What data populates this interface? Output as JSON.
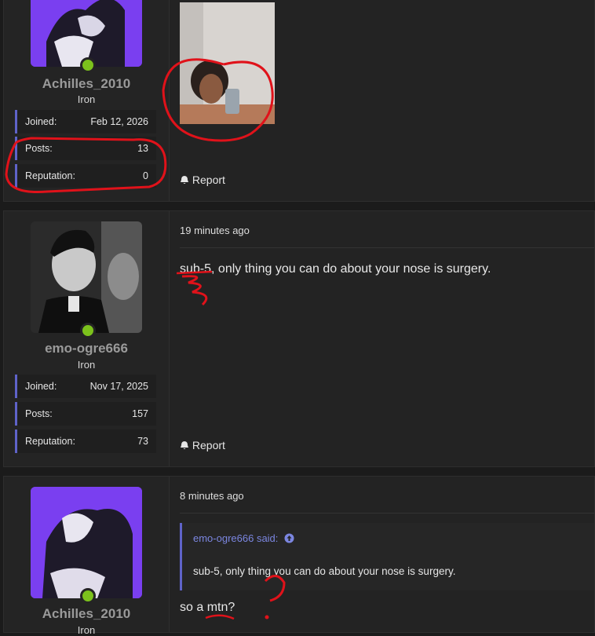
{
  "posts": [
    {
      "username": "Achilles_2010",
      "rank": "Iron",
      "stats": [
        {
          "label": "Joined:",
          "value": "Feb 12, 2026"
        },
        {
          "label": "Posts:",
          "value": "13"
        },
        {
          "label": "Reputation:",
          "value": "0"
        }
      ],
      "report": "Report"
    },
    {
      "username": "emo-ogre666",
      "rank": "Iron",
      "time": "19 minutes ago",
      "text": "sub-5, only thing you can do about your nose is surgery.",
      "stats": [
        {
          "label": "Joined:",
          "value": "Nov 17, 2025"
        },
        {
          "label": "Posts:",
          "value": "157"
        },
        {
          "label": "Reputation:",
          "value": "73"
        }
      ],
      "report": "Report"
    },
    {
      "username": "Achilles_2010",
      "rank": "Iron",
      "time": "8 minutes ago",
      "quote_author": "emo-ogre666 said:",
      "quote_text": "sub-5, only thing you can do about your nose is surgery.",
      "text": "so a mtn?"
    }
  ],
  "colors": {
    "online": "#7cc21c",
    "accent": "#5f63c9",
    "annotation": "#e0121a"
  },
  "icons": {
    "report": "bell-icon",
    "quote_jump": "arrow-up-circle-icon"
  }
}
